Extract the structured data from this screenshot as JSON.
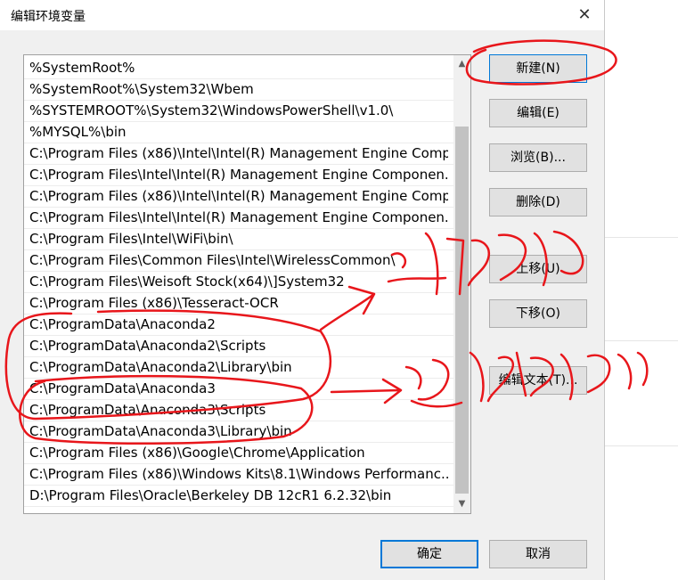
{
  "dialog": {
    "title": "编辑环境变量",
    "close_label": "✕"
  },
  "path_list": {
    "items": [
      "%SystemRoot%",
      "%SystemRoot%\\System32\\Wbem",
      "%SYSTEMROOT%\\System32\\WindowsPowerShell\\v1.0\\",
      "%MYSQL%\\bin",
      "C:\\Program Files (x86)\\Intel\\Intel(R) Management Engine Comp...",
      "C:\\Program Files\\Intel\\Intel(R) Management Engine Componen...",
      "C:\\Program Files (x86)\\Intel\\Intel(R) Management Engine Comp...",
      "C:\\Program Files\\Intel\\Intel(R) Management Engine Componen...",
      "C:\\Program Files\\Intel\\WiFi\\bin\\",
      "C:\\Program Files\\Common Files\\Intel\\WirelessCommon\\",
      "C:\\Program Files\\Weisoft Stock(x64)\\]System32",
      "C:\\Program Files (x86)\\Tesseract-OCR",
      "C:\\ProgramData\\Anaconda2",
      "C:\\ProgramData\\Anaconda2\\Scripts",
      "C:\\ProgramData\\Anaconda2\\Library\\bin",
      "C:\\ProgramData\\Anaconda3",
      "C:\\ProgramData\\Anaconda3\\Scripts",
      "C:\\ProgramData\\Anaconda3\\Library\\bin",
      "C:\\Program Files (x86)\\Google\\Chrome\\Application",
      "C:\\Program Files (x86)\\Windows Kits\\8.1\\Windows Performanc...",
      "D:\\Program Files\\Oracle\\Berkeley DB 12cR1 6.2.32\\bin"
    ]
  },
  "buttons": {
    "new": "新建(N)",
    "edit": "编辑(E)",
    "browse": "浏览(B)...",
    "delete": "删除(D)",
    "move_up": "上移(U)",
    "move_down": "下移(O)",
    "edit_text": "编辑文本(T)...",
    "ok": "确定",
    "cancel": "取消"
  },
  "annotations": {
    "color": "#e8161b",
    "note_installed_before": "之前安装的",
    "note_added_manually": "这次手动添加"
  }
}
